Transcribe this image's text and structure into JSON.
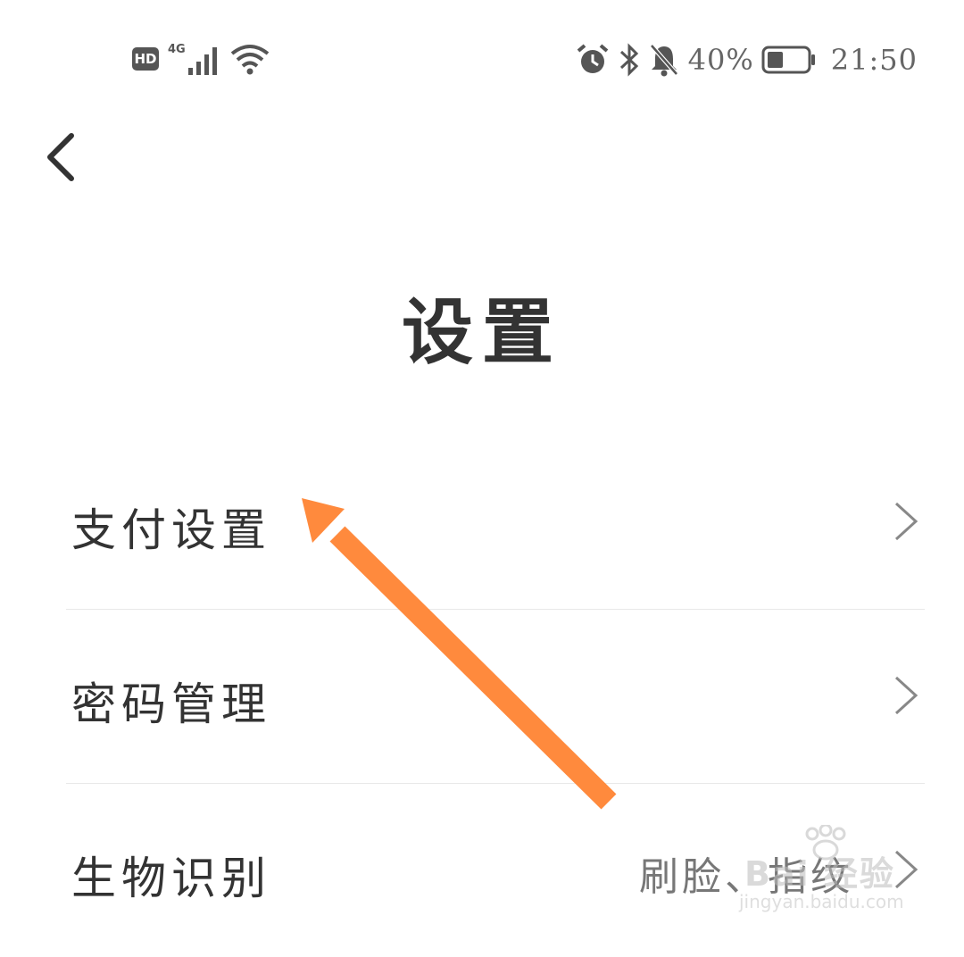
{
  "status_bar": {
    "hd_label": "HD",
    "network_label": "4G",
    "battery_percent": "40%",
    "battery_level": 0.4,
    "time": "21:50",
    "icons": [
      "alarm-icon",
      "bluetooth-icon",
      "bell-muted-icon",
      "wifi-icon",
      "signal-icon",
      "battery-icon"
    ]
  },
  "header": {
    "back_icon": "chevron-left-icon",
    "title": "设置"
  },
  "settings": [
    {
      "label": "支付设置",
      "value": ""
    },
    {
      "label": "密码管理",
      "value": ""
    },
    {
      "label": "生物识别",
      "value": "刷脸、指纹"
    }
  ],
  "watermark": {
    "brand": "Bai 经验",
    "url": "jingyan.baidu.com"
  },
  "colors": {
    "arrow": "#ff8a3d",
    "text": "#333333",
    "muted": "#777777",
    "divider": "#e8e8e8"
  }
}
